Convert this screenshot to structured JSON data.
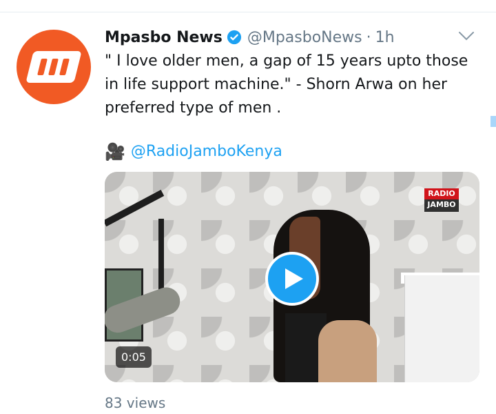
{
  "tweet": {
    "author_name": "Mpasbo News",
    "author_handle": "@MpasboNews",
    "separator": "·",
    "time": "1h",
    "text": "\" I love older men, a gap of 15 years upto those in life support machine.\" - Shorn Arwa on her preferred type of men .",
    "mention": "@RadioJamboKenya",
    "camera_icon": "movie-camera-icon",
    "views": "83 views",
    "avatar_logo_icon": "news-logo-icon"
  },
  "video": {
    "duration": "0:05",
    "watermark_line1": "RADIO",
    "watermark_line2": "JAMBO"
  },
  "colors": {
    "accent": "#1da1f2",
    "avatar_bg": "#f15a24",
    "muted": "#657786"
  }
}
